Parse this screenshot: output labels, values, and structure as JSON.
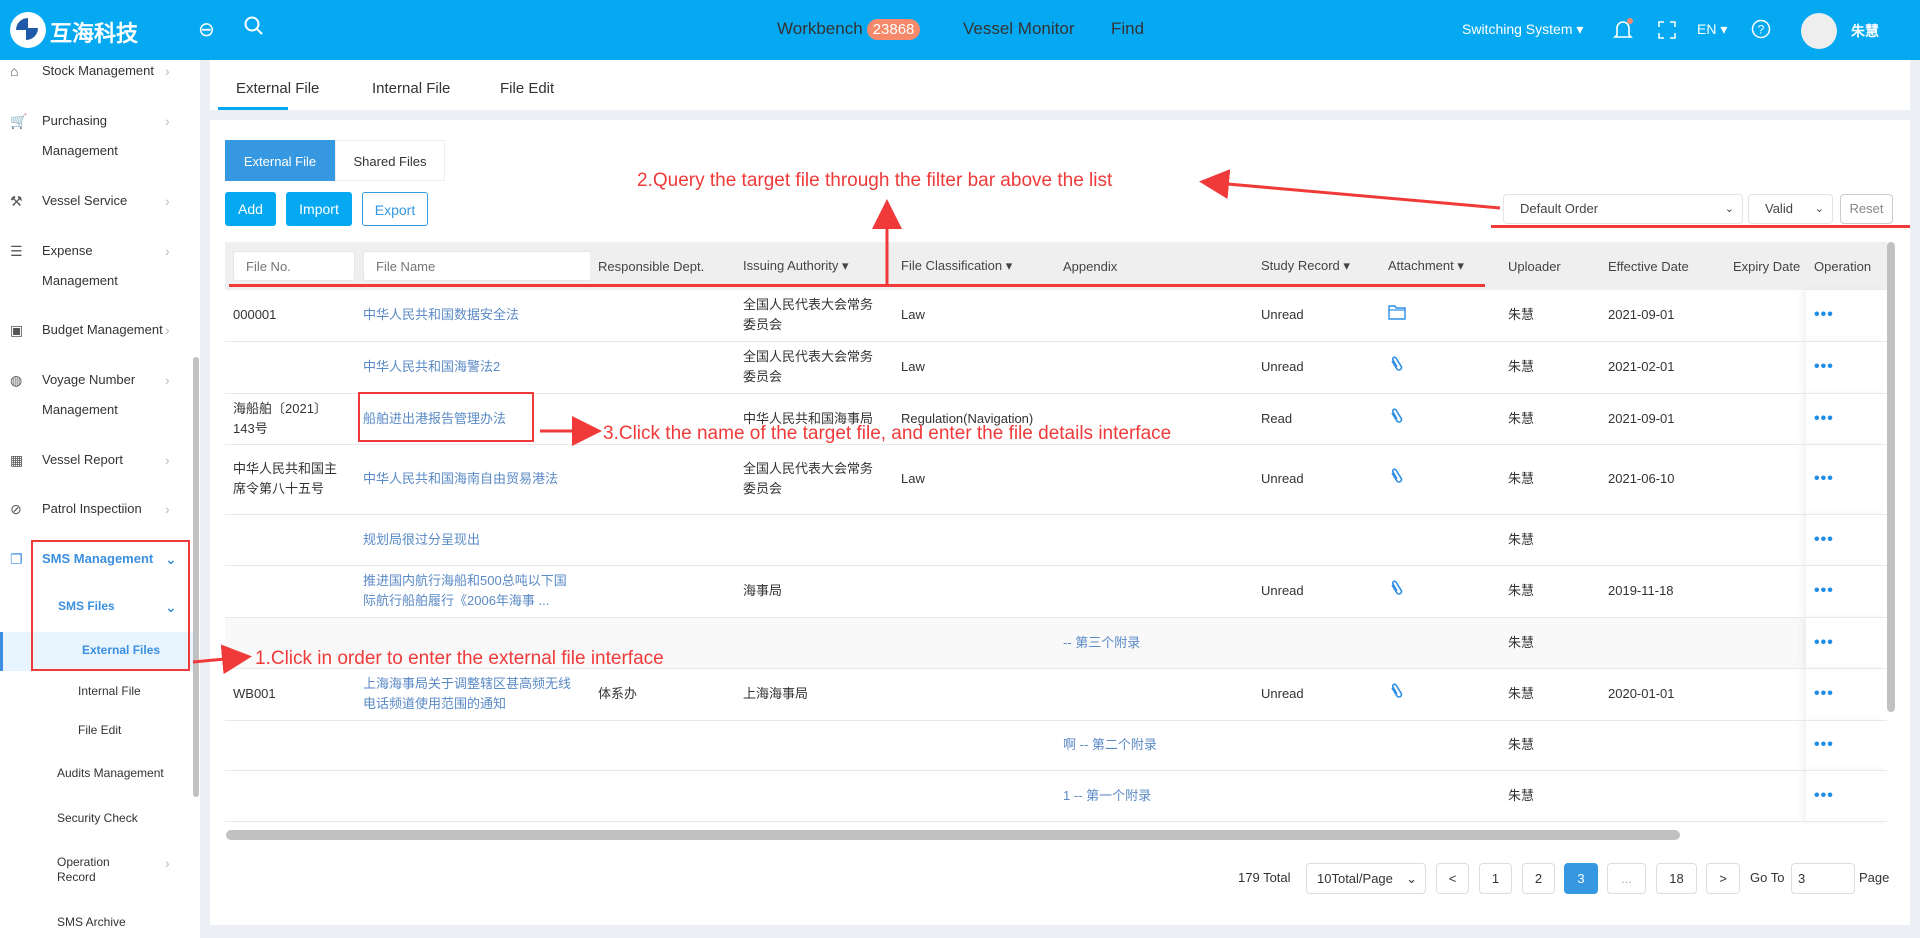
{
  "header": {
    "brand": "互海科技",
    "nav": [
      "Workbench",
      "Vessel Monitor",
      "Find"
    ],
    "workbench_badge": "23868",
    "switch_system": "Switching System",
    "lang": "EN",
    "user": "朱慧",
    "accent": "#05a9f2"
  },
  "sidebar": {
    "items": [
      {
        "label": "Stock Management",
        "icon": "home-icon"
      },
      {
        "label": "Purchasing",
        "label2": "Management",
        "icon": "cart-icon"
      },
      {
        "label": "Vessel Service",
        "icon": "hammer-icon"
      },
      {
        "label": "Expense",
        "label2": "Management",
        "icon": "coins-icon"
      },
      {
        "label": "Budget Management",
        "icon": "budget-icon"
      },
      {
        "label": "Voyage Number",
        "label2": "Management",
        "icon": "globe-icon"
      },
      {
        "label": "Vessel Report",
        "icon": "calendar-icon"
      },
      {
        "label": "Patrol Inspectiion",
        "icon": "check-circle-icon"
      },
      {
        "label": "SMS Management",
        "icon": "files-icon"
      }
    ],
    "sms_sub": {
      "files": "SMS Files",
      "external": "External Files",
      "internal": "Internal File",
      "edit": "File Edit",
      "audits": "Audits Management",
      "security": "Security Check",
      "oprec1": "Operation",
      "oprec2": "Record",
      "archive": "SMS Archive"
    }
  },
  "tabs": [
    "External File",
    "Internal File",
    "File Edit"
  ],
  "subtabs": [
    "External File",
    "Shared Files"
  ],
  "toolbar": {
    "add": "Add",
    "import": "Import",
    "export": "Export"
  },
  "filters": {
    "order": "Default Order",
    "status": "Valid",
    "reset": "Reset",
    "file_no_placeholder": "File No.",
    "file_name_placeholder": "File Name"
  },
  "columns": [
    "Responsible Dept.",
    "Issuing Authority",
    "File Classification",
    "Appendix",
    "Study Record",
    "Attachment",
    "Uploader",
    "Effective Date",
    "Expiry Date",
    "Operation"
  ],
  "rows": [
    {
      "no": "000001",
      "name": "中华人民共和国数据安全法",
      "dept": "",
      "authority": "全国人民代表大会常务委员会",
      "cls": "Law",
      "appendix": "",
      "study": "Unread",
      "attach": "folder",
      "uploader": "朱慧",
      "eff": "2021-09-01"
    },
    {
      "no": "",
      "name": "中华人民共和国海警法2",
      "dept": "",
      "authority": "全国人民代表大会常务委员会",
      "cls": "Law",
      "appendix": "",
      "study": "Unread",
      "attach": "clip",
      "uploader": "朱慧",
      "eff": "2021-02-01"
    },
    {
      "no": "海船舶〔2021〕143号",
      "name": "船舶进出港报告管理办法",
      "dept": "",
      "authority": "中华人民共和国海事局",
      "cls": "Regulation(Navigation)",
      "appendix": "",
      "study": "Read",
      "attach": "clip",
      "uploader": "朱慧",
      "eff": "2021-09-01"
    },
    {
      "no": "中华人民共和国主席令第八十五号",
      "name": "中华人民共和国海南自由贸易港法",
      "dept": "",
      "authority": "全国人民代表大会常务委员会",
      "cls": "Law",
      "appendix": "",
      "study": "Unread",
      "attach": "clip",
      "uploader": "朱慧",
      "eff": "2021-06-10"
    },
    {
      "no": "",
      "name": "规划局很过分呈现出",
      "dept": "",
      "authority": "",
      "cls": "",
      "appendix": "",
      "study": "",
      "attach": "",
      "uploader": "朱慧",
      "eff": ""
    },
    {
      "no": "",
      "name": "推进国内航行海船和500总吨以下国际航行船舶履行《2006年海事 ...",
      "dept": "",
      "authority": "海事局",
      "cls": "",
      "appendix": "",
      "study": "Unread",
      "attach": "clip",
      "uploader": "朱慧",
      "eff": "2019-11-18"
    },
    {
      "no": "",
      "name": "",
      "dept": "",
      "authority": "",
      "cls": "",
      "appendix": "-- 第三个附录",
      "study": "",
      "attach": "",
      "uploader": "朱慧",
      "eff": ""
    },
    {
      "no": "WB001",
      "name": "上海海事局关于调整辖区甚高频无线电话频道使用范围的通知",
      "dept": "体系办",
      "authority": "上海海事局",
      "cls": "",
      "appendix": "",
      "study": "Unread",
      "attach": "clip",
      "uploader": "朱慧",
      "eff": "2020-01-01"
    },
    {
      "no": "",
      "name": "",
      "dept": "",
      "authority": "",
      "cls": "",
      "appendix": "啊 -- 第二个附录",
      "study": "",
      "attach": "",
      "uploader": "朱慧",
      "eff": ""
    },
    {
      "no": "",
      "name": "",
      "dept": "",
      "authority": "",
      "cls": "",
      "appendix": "1 -- 第一个附录",
      "study": "",
      "attach": "",
      "uploader": "朱慧",
      "eff": ""
    }
  ],
  "pagination": {
    "total": "179 Total",
    "per_page": "10Total/Page",
    "prev": "<",
    "pages": [
      "1",
      "2",
      "3",
      "...",
      "18"
    ],
    "current": "3",
    "next": ">",
    "goto_label": "Go To",
    "goto_value": "3",
    "page_label": "Page"
  },
  "annotations": {
    "a1": "1.Click in order to enter the external file interface",
    "a2": "2.Query the target file through the filter bar above the list",
    "a3": "3.Click the name of the target file, and enter the file details interface",
    "color": "#f03a3a"
  }
}
